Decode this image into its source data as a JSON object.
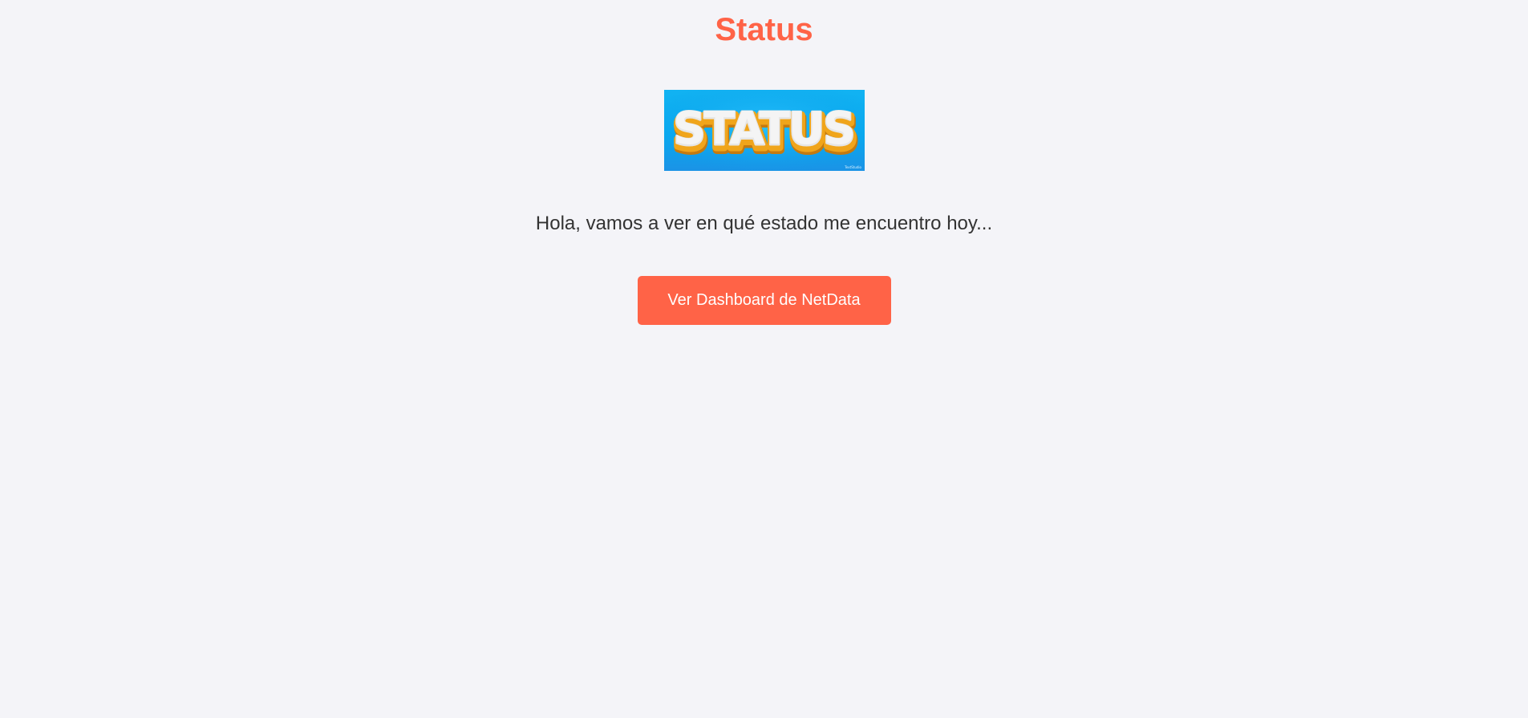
{
  "page": {
    "title": "Status",
    "message": "Hola, vamos a ver en qué estado me encuentro hoy...",
    "button_label": "Ver Dashboard de NetData"
  },
  "banner": {
    "text": "STATUS",
    "watermark": "TextStudio",
    "background_color": "#08a9ef",
    "text_color": "#f2f2f2",
    "outline_color": "#f0a51b"
  },
  "colors": {
    "accent": "#ff6347",
    "page_background": "#f4f4f8",
    "body_text": "#333333"
  }
}
